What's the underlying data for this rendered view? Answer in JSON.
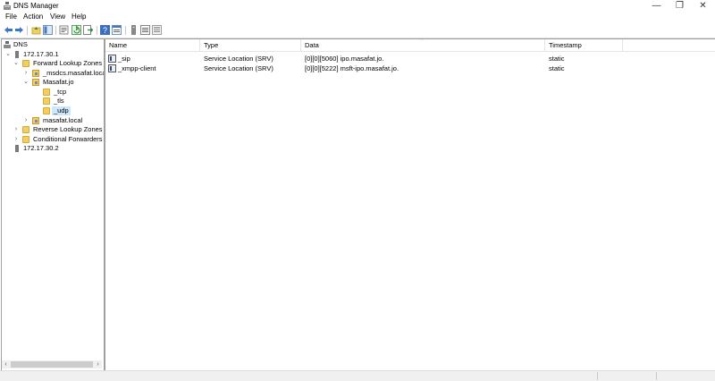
{
  "window": {
    "title": "DNS Manager",
    "controls": {
      "minimize": "—",
      "maximize": "❐",
      "close": "✕"
    }
  },
  "menu": [
    "File",
    "Action",
    "View",
    "Help"
  ],
  "toolbar": {
    "buttons": [
      "back-icon",
      "forward-icon",
      "up-folder-icon",
      "show-tree-icon",
      "properties-icon",
      "refresh-icon",
      "export-list-icon",
      "help-icon",
      "console-icon",
      "server-icon",
      "list-icon",
      "details-icon"
    ]
  },
  "tree": {
    "nodes": [
      {
        "label": "DNS",
        "expander": "",
        "icon": "dns-icon"
      },
      {
        "label": "172.17.30.1",
        "expander": "⌄",
        "icon": "server-icon"
      },
      {
        "label": "Forward Lookup Zones",
        "expander": "⌄",
        "icon": "folder-icon"
      },
      {
        "label": "_msdcs.masafat.local",
        "expander": "›",
        "icon": "zone-icon"
      },
      {
        "label": "Masafat.jo",
        "expander": "⌄",
        "icon": "zone-icon"
      },
      {
        "label": "_tcp",
        "expander": "",
        "icon": "folder-icon"
      },
      {
        "label": "_tls",
        "expander": "",
        "icon": "folder-icon"
      },
      {
        "label": "_udp",
        "expander": "",
        "icon": "folder-icon"
      },
      {
        "label": "masafat.local",
        "expander": "›",
        "icon": "zone-icon"
      },
      {
        "label": "Reverse Lookup Zones",
        "expander": "›",
        "icon": "folder-icon"
      },
      {
        "label": "Conditional Forwarders",
        "expander": "›",
        "icon": "folder-icon"
      },
      {
        "label": "172.17.30.2",
        "expander": "",
        "icon": "server-icon"
      }
    ],
    "selected": "_udp",
    "hscroll": {
      "left": "‹",
      "right": "›"
    }
  },
  "list": {
    "columns": [
      "Name",
      "Type",
      "Data",
      "Timestamp"
    ],
    "sort_indicator": "^",
    "rows": [
      {
        "name": "_sip",
        "type": "Service Location (SRV)",
        "data": "[0][0][5060] ipo.masafat.jo.",
        "timestamp": "static"
      },
      {
        "name": "_xmpp-client",
        "type": "Service Location (SRV)",
        "data": "[0][0][5222] msft-ipo.masafat.jo.",
        "timestamp": "static"
      }
    ]
  }
}
